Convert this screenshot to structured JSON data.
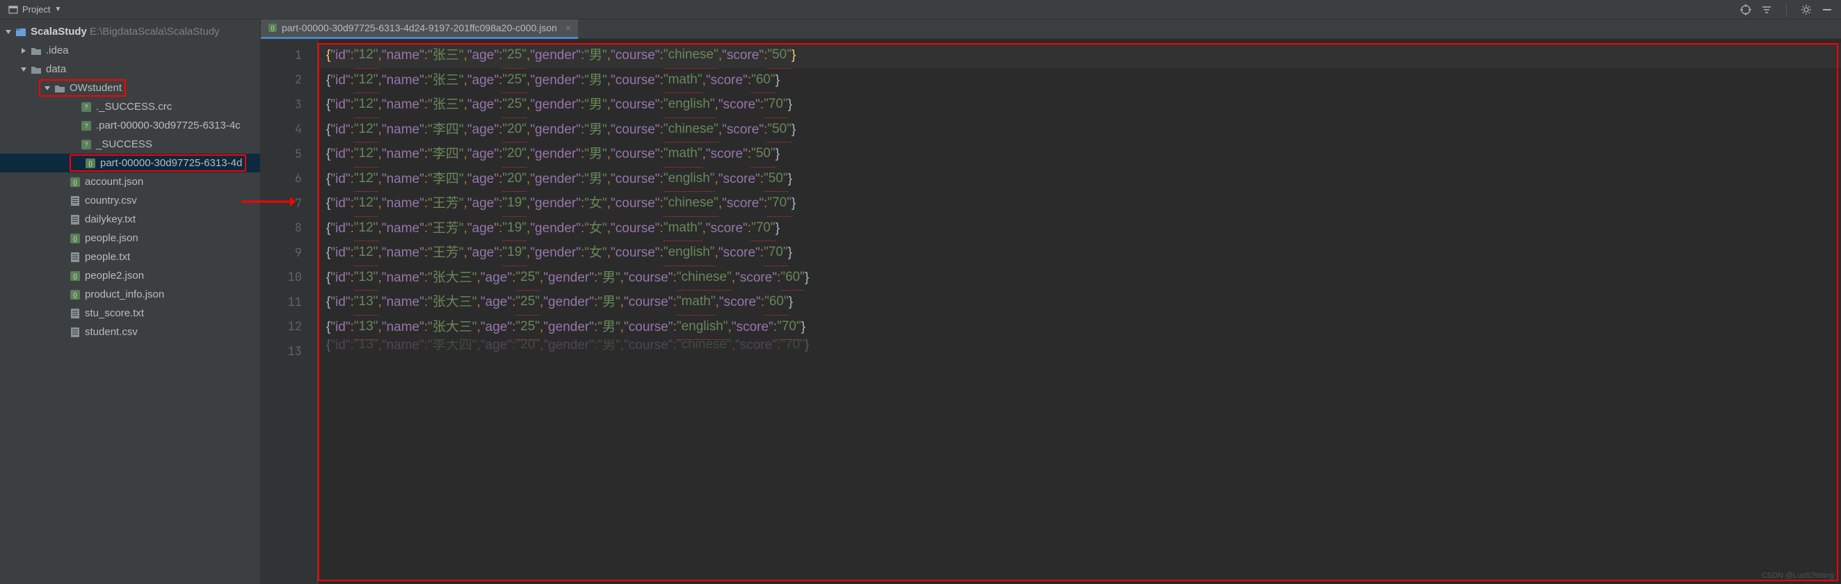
{
  "toolbar": {
    "project_label": "Project"
  },
  "tree": {
    "root_name": "ScalaStudy",
    "root_path": "E:\\BigdataScala\\ScalaStudy",
    "nodes": [
      {
        "label": ".idea",
        "indent": 28,
        "arrow": "right",
        "icon": "folder"
      },
      {
        "label": "data",
        "indent": 28,
        "arrow": "down",
        "icon": "folder"
      },
      {
        "label": "OWstudent",
        "indent": 56,
        "arrow": "down",
        "icon": "folder",
        "red": true
      },
      {
        "label": "._SUCCESS.crc",
        "indent": 100,
        "arrow": "",
        "icon": "jsonq"
      },
      {
        "label": ".part-00000-30d97725-6313-4c",
        "indent": 100,
        "arrow": "",
        "icon": "jsonq"
      },
      {
        "label": "_SUCCESS",
        "indent": 100,
        "arrow": "",
        "icon": "jsonq"
      },
      {
        "label": "part-00000-30d97725-6313-4d",
        "indent": 100,
        "arrow": "",
        "icon": "json",
        "red": true,
        "selected": true
      },
      {
        "label": "account.json",
        "indent": 84,
        "arrow": "",
        "icon": "json"
      },
      {
        "label": "country.csv",
        "indent": 84,
        "arrow": "",
        "icon": "file"
      },
      {
        "label": "dailykey.txt",
        "indent": 84,
        "arrow": "",
        "icon": "file"
      },
      {
        "label": "people.json",
        "indent": 84,
        "arrow": "",
        "icon": "json"
      },
      {
        "label": "people.txt",
        "indent": 84,
        "arrow": "",
        "icon": "file"
      },
      {
        "label": "people2.json",
        "indent": 84,
        "arrow": "",
        "icon": "json"
      },
      {
        "label": "product_info.json",
        "indent": 84,
        "arrow": "",
        "icon": "json"
      },
      {
        "label": "stu_score.txt",
        "indent": 84,
        "arrow": "",
        "icon": "file"
      },
      {
        "label": "student.csv",
        "indent": 84,
        "arrow": "",
        "icon": "file"
      }
    ]
  },
  "tab": {
    "title": "part-00000-30d97725-6313-4d24-9197-201ffc098a20-c000.json"
  },
  "gutter": [
    "1",
    "2",
    "3",
    "4",
    "5",
    "6",
    "7",
    "8",
    "9",
    "10",
    "11",
    "12",
    "13"
  ],
  "lines": [
    {
      "current": true,
      "open_yellow": true,
      "close_yellow": true,
      "id": "12",
      "name": "张三",
      "age": "25",
      "gender": "男",
      "course": "chinese",
      "score": "50"
    },
    {
      "id": "12",
      "name": "张三",
      "age": "25",
      "gender": "男",
      "course": "math",
      "score": "60"
    },
    {
      "id": "12",
      "name": "张三",
      "age": "25",
      "gender": "男",
      "course": "english",
      "score": "70"
    },
    {
      "id": "12",
      "name": "李四",
      "age": "20",
      "gender": "男",
      "course": "chinese",
      "score": "50"
    },
    {
      "id": "12",
      "name": "李四",
      "age": "20",
      "gender": "男",
      "course": "math",
      "score": "50"
    },
    {
      "id": "12",
      "name": "李四",
      "age": "20",
      "gender": "男",
      "course": "english",
      "score": "50"
    },
    {
      "id": "12",
      "name": "王芳",
      "age": "19",
      "gender": "女",
      "course": "chinese",
      "score": "70"
    },
    {
      "id": "12",
      "name": "王芳",
      "age": "19",
      "gender": "女",
      "course": "math",
      "score": "70"
    },
    {
      "id": "12",
      "name": "王芳",
      "age": "19",
      "gender": "女",
      "course": "english",
      "score": "70"
    },
    {
      "id": "13",
      "name": "张大三",
      "age": "25",
      "gender": "男",
      "course": "chinese",
      "score": "60"
    },
    {
      "id": "13",
      "name": "张大三",
      "age": "25",
      "gender": "男",
      "course": "math",
      "score": "60"
    },
    {
      "id": "13",
      "name": "张大三",
      "age": "25",
      "gender": "男",
      "course": "english",
      "score": "70"
    },
    {
      "partial": true,
      "id": "13",
      "name": "李大四",
      "age": "20",
      "gender": "男",
      "course": "chinese",
      "score": "70"
    }
  ],
  "watermark": "CSDN @Luo52Wang"
}
